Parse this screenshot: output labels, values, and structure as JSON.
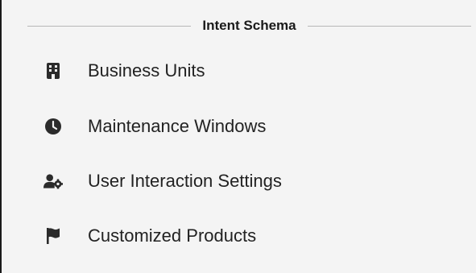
{
  "section": {
    "title": "Intent Schema"
  },
  "menu": {
    "items": [
      {
        "label": "Business Units",
        "icon": "building-icon"
      },
      {
        "label": "Maintenance Windows",
        "icon": "clock-icon"
      },
      {
        "label": "User Interaction Settings",
        "icon": "user-gear-icon"
      },
      {
        "label": "Customized Products",
        "icon": "flag-icon"
      }
    ]
  },
  "colors": {
    "background": "#f4f4f4",
    "icon": "#2b2b2b",
    "text": "#222222",
    "divider": "#b8b8b8"
  }
}
